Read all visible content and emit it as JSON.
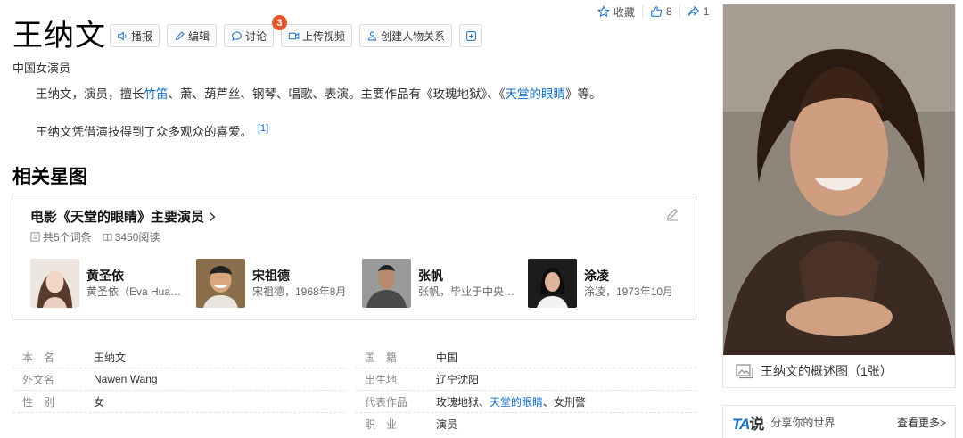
{
  "top_actions": {
    "collect_label": "收藏",
    "like_count": "8",
    "share_count": "1"
  },
  "title": "王纳文",
  "toolbar": {
    "broadcast": "播报",
    "edit": "编辑",
    "discuss": "讨论",
    "discuss_badge": "3",
    "upload_video": "上传视频",
    "create_relation": "创建人物关系"
  },
  "subtitle": "中国女演员",
  "summary": {
    "p1_before": "王纳文，演员，擅长",
    "p1_link1": "竹笛",
    "p1_mid": "、萧、葫芦丝、钢琴、唱歌、表演。主要作品有《玫瑰地狱》、《",
    "p1_link2": "天堂的眼睛",
    "p1_after": "》等。",
    "p2": "王纳文凭借演技得到了众多观众的喜爱。",
    "p2_ref": "[1]"
  },
  "section_title": "相关星图",
  "star_card": {
    "title": "电影《天堂的眼睛》主要演员",
    "entries": "共5个词条",
    "reads": "3450阅读",
    "people": [
      {
        "name": "黄圣依",
        "desc": "黄圣依（Eva Huang）"
      },
      {
        "name": "宋祖德",
        "desc": "宋祖德，1968年8月"
      },
      {
        "name": "张帆",
        "desc": "张帆，毕业于中央戏剧学院"
      },
      {
        "name": "涂凌",
        "desc": "涂凌，1973年10月"
      }
    ]
  },
  "info_left": [
    {
      "label": "本名",
      "value": "王纳文"
    },
    {
      "label": "外文名",
      "value": "Nawen Wang"
    },
    {
      "label": "性别",
      "value": "女"
    }
  ],
  "info_right": {
    "nationality_label": "国籍",
    "nationality_value": "中国",
    "birthplace_label": "出生地",
    "birthplace_value": "辽宁沈阳",
    "works_label": "代表作品",
    "works_a": "玫瑰地狱、",
    "works_link": "天堂的眼睛",
    "works_b": "、女刑警",
    "job_label": "职业",
    "job_value": "演员"
  },
  "photo": {
    "caption": "王纳文的概述图（1张）"
  },
  "ta": {
    "logo_a": "TA",
    "logo_b": "说",
    "slogan": "分享你的世界",
    "more": "查看更多>"
  },
  "colors": {
    "link": "#136ec2",
    "badge": "#e7562f"
  }
}
